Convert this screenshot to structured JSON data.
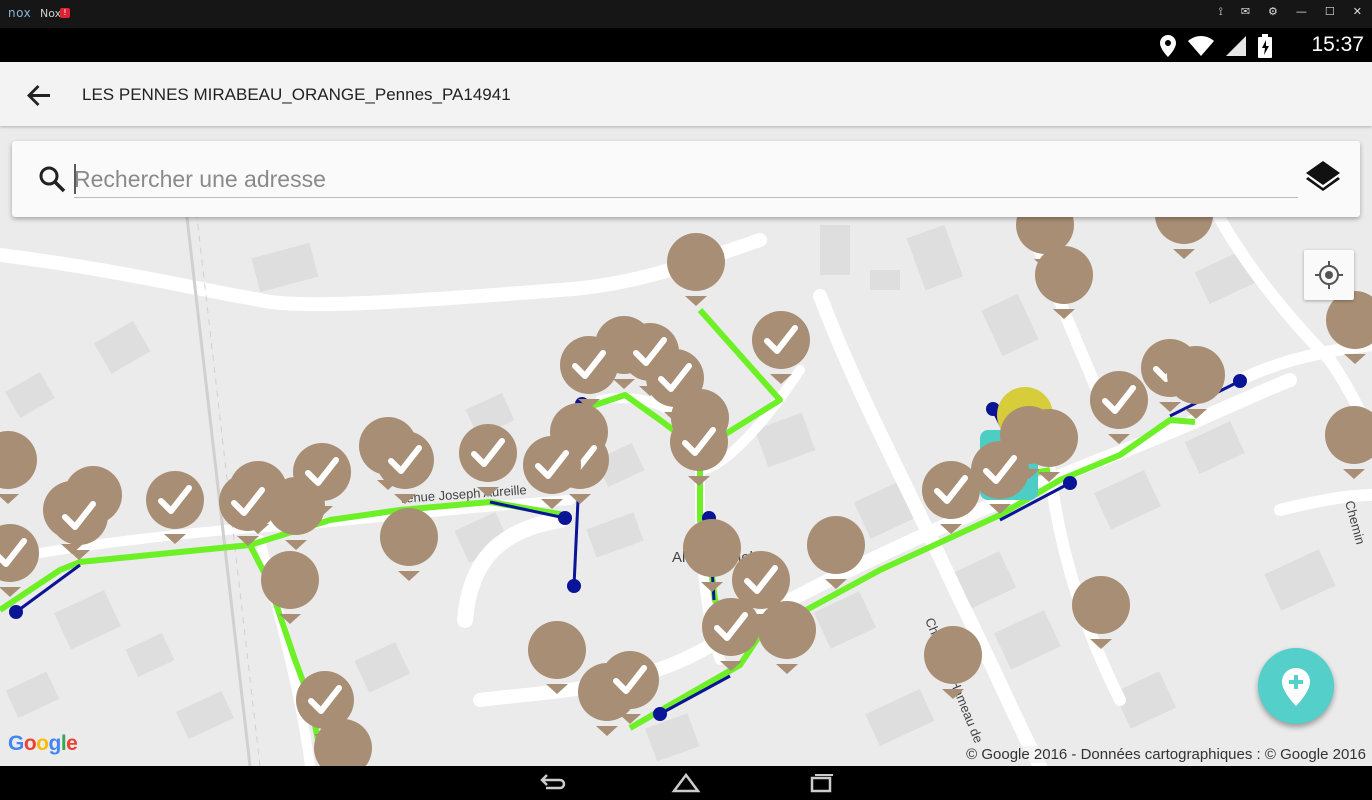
{
  "emulator": {
    "name": "Nox",
    "logo": "nox",
    "badge": "!"
  },
  "status_bar": {
    "time": "15:37",
    "icons": [
      "location-icon",
      "wifi-icon",
      "signal-icon",
      "battery-icon"
    ]
  },
  "app_bar": {
    "title": "LES PENNES MIRABEAU_ORANGE_Pennes_PA14941",
    "back_icon": "arrow-back-icon"
  },
  "search": {
    "placeholder": "Rechercher une adresse",
    "value": ""
  },
  "map": {
    "street_labels": [
      "venue Joseph Aureille",
      "Allée Michel",
      "Chemin",
      "Chemin du Hameau de"
    ],
    "attribution": "© Google 2016 - Données cartographiques : © Google 2016",
    "google_logo": "Google"
  },
  "colors": {
    "marker": "#a88e74",
    "route": "#6ef027",
    "drop_line": "#0a1496",
    "fab": "#54cfc9",
    "selected": "#4ecdc4",
    "highlight": "#d7cc3a"
  }
}
